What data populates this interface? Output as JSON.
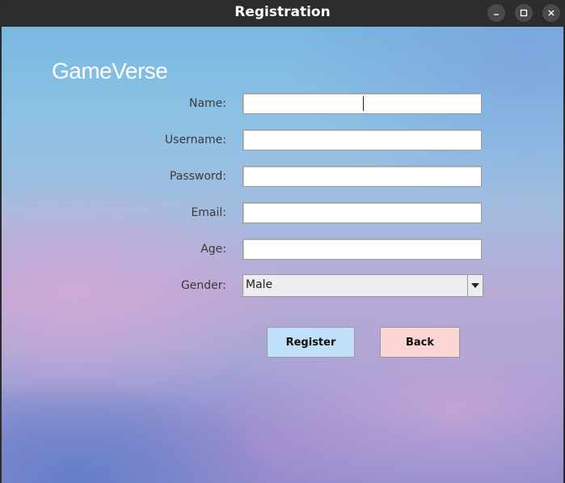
{
  "window": {
    "title": "Registration",
    "controls": [
      "minimize",
      "maximize",
      "close"
    ]
  },
  "logo": {
    "text": "GameVerse"
  },
  "form": {
    "name": {
      "label": "Name:",
      "value": ""
    },
    "username": {
      "label": "Username:",
      "value": ""
    },
    "password": {
      "label": "Password:",
      "value": ""
    },
    "email": {
      "label": "Email:",
      "value": ""
    },
    "age": {
      "label": "Age:",
      "value": ""
    },
    "gender": {
      "label": "Gender:",
      "selected": "Male"
    }
  },
  "buttons": {
    "register": "Register",
    "back": "Back"
  },
  "colors": {
    "titlebar": "#2c2c2c",
    "register_bg": "#bfe0f8",
    "back_bg": "#fbd4d4"
  }
}
